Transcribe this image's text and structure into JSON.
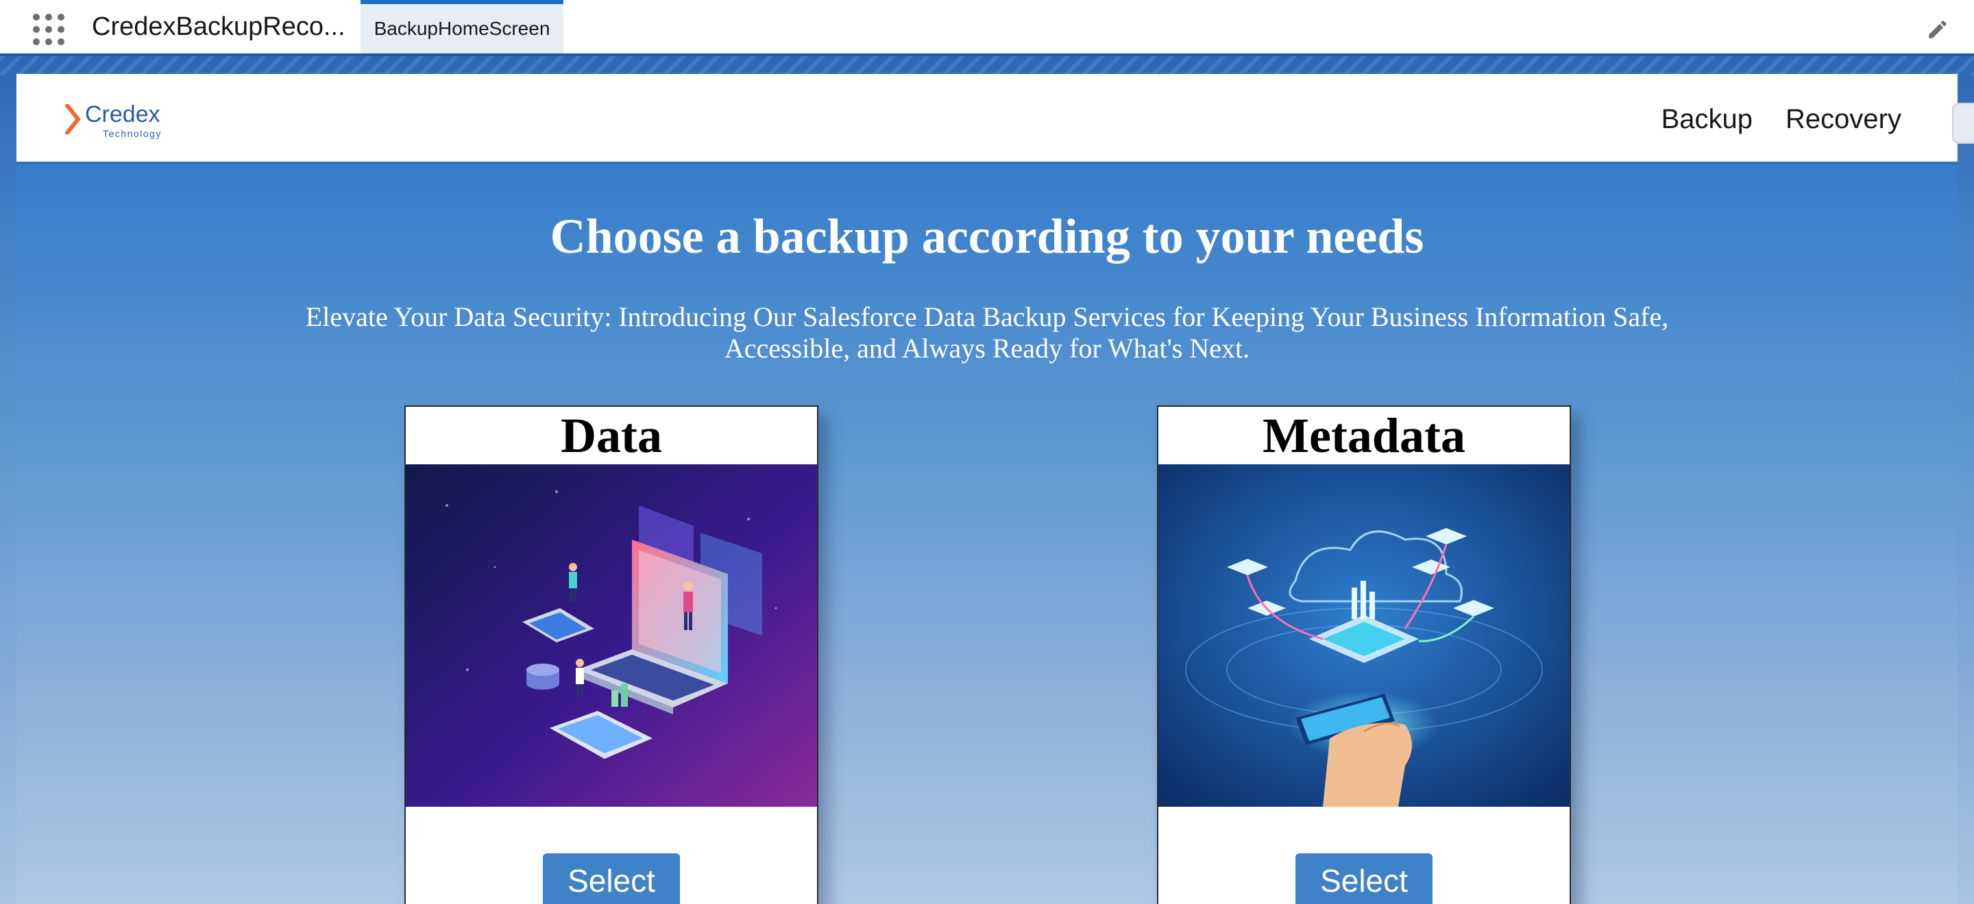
{
  "app": {
    "name": "CredexBackupReco...",
    "active_tab": "BackupHomeScreen",
    "icons": {
      "launcher": "app-launcher-icon",
      "edit": "pencil-icon"
    }
  },
  "navbar": {
    "logo": {
      "word": "Credex",
      "sub": "Technology"
    },
    "links": [
      "Backup",
      "Recovery"
    ]
  },
  "hero": {
    "title": "Choose a backup according to your needs",
    "subtitle_line1": "Elevate Your Data Security: Introducing Our Salesforce Data Backup Services for Keeping Your Business Information Safe,",
    "subtitle_line2": "Accessible, and Always Ready for What's Next."
  },
  "cards": [
    {
      "title": "Data",
      "button": "Select",
      "image": "data-laptop-illustration"
    },
    {
      "title": "Metadata",
      "button": "Select",
      "image": "metadata-phone-cloud-illustration"
    }
  ],
  "colors": {
    "accent": "#1b6ec2",
    "button": "#3f82c8",
    "logo_orange": "#f06a28",
    "logo_blue": "#2b5aa8"
  }
}
